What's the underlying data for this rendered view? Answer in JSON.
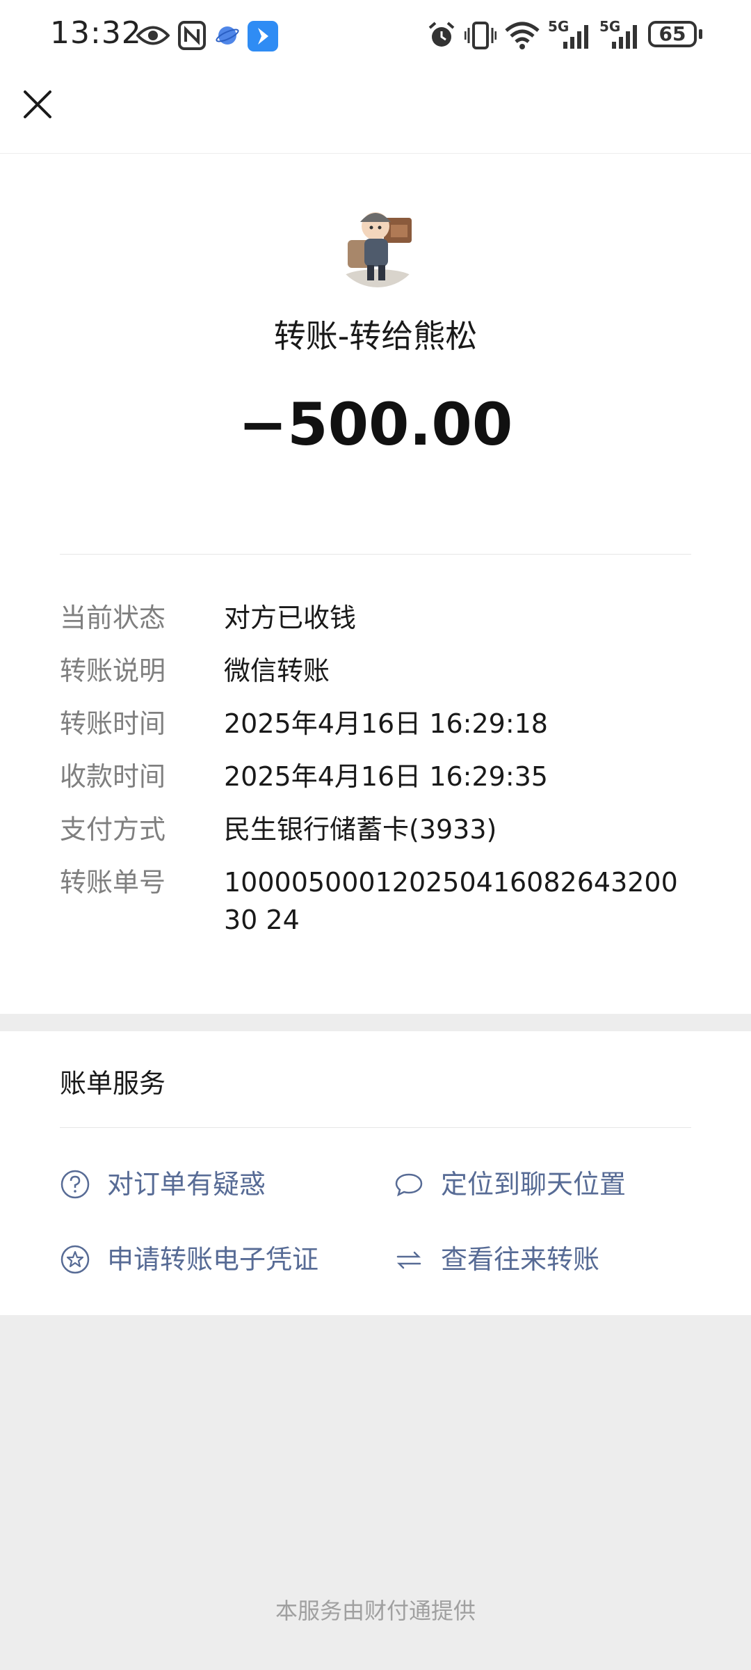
{
  "status_bar": {
    "time": "13:32",
    "battery": "65",
    "signal_label_1": "5G",
    "signal_label_2": "5G"
  },
  "nav": {
    "close_icon": "close-icon"
  },
  "transfer": {
    "title": "转账-转给熊松",
    "amount": "−500.00"
  },
  "details": [
    {
      "label": "当前状态",
      "value": "对方已收钱"
    },
    {
      "label": "转账说明",
      "value": "微信转账"
    },
    {
      "label": "转账时间",
      "value": "2025年4月16日 16:29:18"
    },
    {
      "label": "收款时间",
      "value": "2025年4月16日 16:29:35"
    },
    {
      "label": "支付方式",
      "value": "民生银行储蓄卡(3933)"
    },
    {
      "label": "转账单号",
      "value": "10000500012025041608264320030 24"
    }
  ],
  "services": {
    "title": "账单服务",
    "items": [
      {
        "label": "对订单有疑惑",
        "icon": "question-circle-icon"
      },
      {
        "label": "定位到聊天位置",
        "icon": "chat-bubble-icon"
      },
      {
        "label": "申请转账电子凭证",
        "icon": "star-circle-icon"
      },
      {
        "label": "查看往来转账",
        "icon": "swap-arrows-icon"
      }
    ]
  },
  "footer": "本服务由财付通提供",
  "colors": {
    "link": "#576b95",
    "label": "#7f7f7f",
    "background": "#ededed"
  }
}
